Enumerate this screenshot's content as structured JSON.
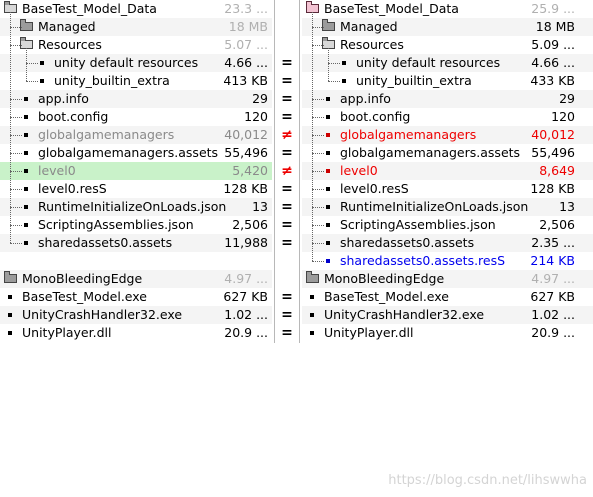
{
  "left": {
    "rows": [
      {
        "name": "BaseTest_Model_Data",
        "size": "23.3 ..."
      },
      {
        "name": "Managed",
        "size": "18 MB"
      },
      {
        "name": "Resources",
        "size": "5.07 ..."
      },
      {
        "name": "unity default resources",
        "size": "4.66 ..."
      },
      {
        "name": "unity_builtin_extra",
        "size": "413 KB"
      },
      {
        "name": "app.info",
        "size": "29"
      },
      {
        "name": "boot.config",
        "size": "120"
      },
      {
        "name": "globalgamemanagers",
        "size": "40,012"
      },
      {
        "name": "globalgamemanagers.assets",
        "size": "55,496"
      },
      {
        "name": "level0",
        "size": "5,420"
      },
      {
        "name": "level0.resS",
        "size": "128 KB"
      },
      {
        "name": "RuntimeInitializeOnLoads.json",
        "size": "13"
      },
      {
        "name": "ScriptingAssemblies.json",
        "size": "2,506"
      },
      {
        "name": "sharedassets0.assets",
        "size": "11,988"
      },
      {
        "name": "MonoBleedingEdge",
        "size": "4.97 ..."
      },
      {
        "name": "BaseTest_Model.exe",
        "size": "627 KB"
      },
      {
        "name": "UnityCrashHandler32.exe",
        "size": "1.02 ..."
      },
      {
        "name": "UnityPlayer.dll",
        "size": "20.9 ..."
      }
    ]
  },
  "right": {
    "rows": [
      {
        "name": "BaseTest_Model_Data",
        "size": "25.9 ..."
      },
      {
        "name": "Managed",
        "size": "18 MB"
      },
      {
        "name": "Resources",
        "size": "5.09 ..."
      },
      {
        "name": "unity default resources",
        "size": "4.66 ..."
      },
      {
        "name": "unity_builtin_extra",
        "size": "433 KB"
      },
      {
        "name": "app.info",
        "size": "29"
      },
      {
        "name": "boot.config",
        "size": "120"
      },
      {
        "name": "globalgamemanagers",
        "size": "40,012"
      },
      {
        "name": "globalgamemanagers.assets",
        "size": "55,496"
      },
      {
        "name": "level0",
        "size": "8,649"
      },
      {
        "name": "level0.resS",
        "size": "128 KB"
      },
      {
        "name": "RuntimeInitializeOnLoads.json",
        "size": "13"
      },
      {
        "name": "ScriptingAssemblies.json",
        "size": "2,506"
      },
      {
        "name": "sharedassets0.assets",
        "size": "2.35 ..."
      },
      {
        "name": "sharedassets0.assets.resS",
        "size": "214 KB"
      },
      {
        "name": "MonoBleedingEdge",
        "size": "4.97 ..."
      },
      {
        "name": "BaseTest_Model.exe",
        "size": "627 KB"
      },
      {
        "name": "UnityCrashHandler32.exe",
        "size": "1.02 ..."
      },
      {
        "name": "UnityPlayer.dll",
        "size": "20.9 ..."
      }
    ]
  },
  "compare": [
    {
      "symbol": "="
    },
    {
      "symbol": "="
    },
    {
      "symbol": "="
    },
    {
      "symbol": "="
    },
    {
      "symbol": "≠"
    },
    {
      "symbol": "="
    },
    {
      "symbol": "≠"
    },
    {
      "symbol": "="
    },
    {
      "symbol": "="
    },
    {
      "symbol": "="
    },
    {
      "symbol": "="
    },
    {
      "symbol": "="
    },
    {
      "symbol": "="
    },
    {
      "symbol": "="
    },
    {
      "symbol": "="
    }
  ],
  "watermark": "https://blog.csdn.net/lihswwha"
}
